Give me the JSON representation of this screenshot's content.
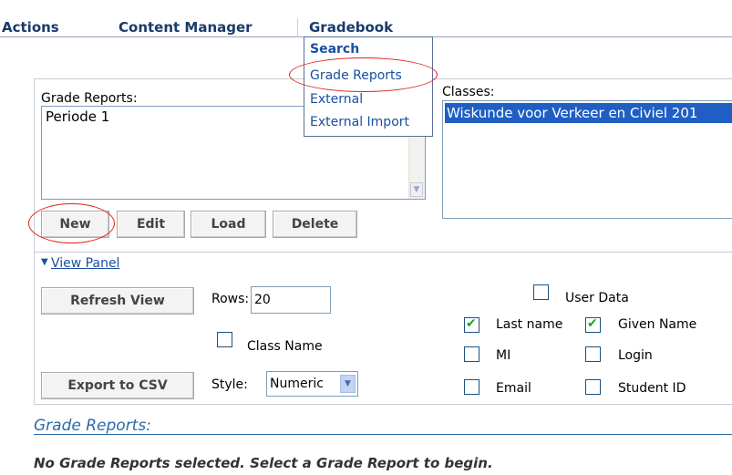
{
  "menu": {
    "items": [
      {
        "label": "Actions"
      },
      {
        "label": "Content Manager"
      },
      {
        "label": "Gradebook"
      }
    ],
    "dropdown": [
      "Search",
      "Grade Reports",
      "External",
      "External Import"
    ]
  },
  "grade_reports": {
    "label": "Grade Reports:",
    "items": [
      "Periode 1"
    ]
  },
  "classes": {
    "label": "Classes:",
    "items": [
      "Wiskunde voor Verkeer en Civiel 201"
    ]
  },
  "buttons": {
    "new": "New",
    "edit": "Edit",
    "load": "Load",
    "delete": "Delete"
  },
  "view_panel": {
    "toggle": "View Panel",
    "refresh": "Refresh View",
    "rows_label": "Rows:",
    "rows_value": "20",
    "class_name": "Class Name",
    "export": "Export to CSV",
    "style_label": "Style:",
    "style_value": "Numeric",
    "user_data": "User Data",
    "fields": {
      "last_name": {
        "label": "Last name",
        "checked": true
      },
      "given_name": {
        "label": "Given Name",
        "checked": true
      },
      "mi": {
        "label": "MI",
        "checked": false
      },
      "login": {
        "label": "Login",
        "checked": false
      },
      "email": {
        "label": "Email",
        "checked": false
      },
      "student_id": {
        "label": "Student ID",
        "checked": false
      }
    }
  },
  "section_title": "Grade Reports:",
  "empty_message": "No Grade Reports selected. Select a Grade Report to begin.",
  "colors": {
    "accent": "#1a3a6b",
    "link": "#1a4fa0",
    "highlight": "#e02020",
    "selection": "#1f5fc3"
  }
}
